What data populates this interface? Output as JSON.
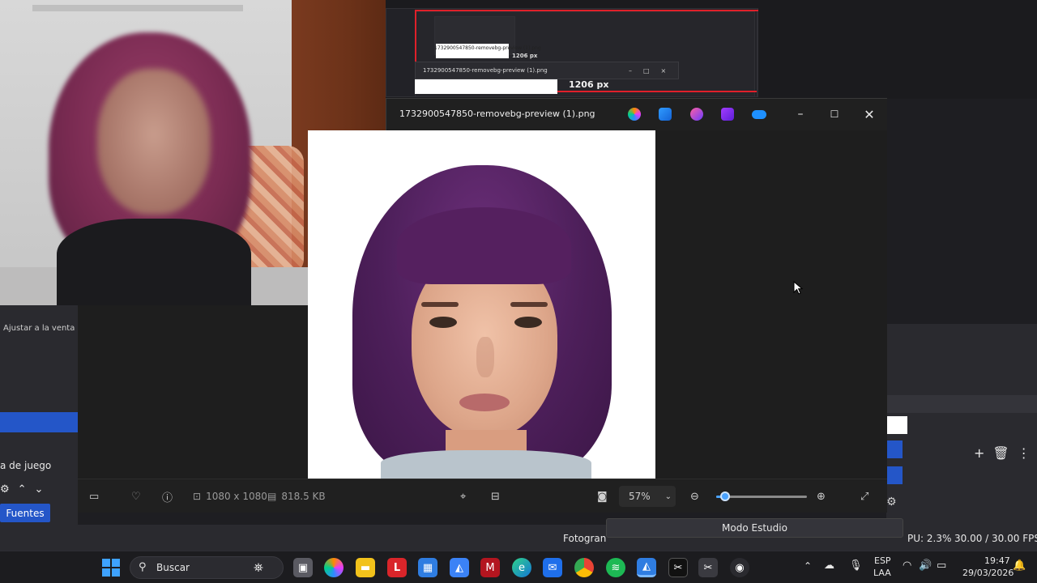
{
  "colors": {
    "accent": "#2456c8",
    "zoom_accent": "#4aa3ff",
    "window_bg": "#202020",
    "red_outline": "#e0202a"
  },
  "nested_capture": {
    "title_small": "1732900547850-removebg-preview (1).png",
    "px_small": "1206 px",
    "px_large": "1206 px"
  },
  "obs": {
    "fit_window": "Ajustar a la venta",
    "game_capture": "a de juego",
    "sources_tab": "Fuentes",
    "fotogram": "Fotogran",
    "studio_mode": "Modo Estudio",
    "cpu": "PU: 2.3%",
    "fps": "30.00 / 30.00 FPS"
  },
  "photos": {
    "title": "1732900547850-removebg-preview (1).png",
    "dimensions": "1080 x 1080",
    "file_size": "818.5 KB",
    "zoom": "57%",
    "zoom_fraction": 0.1
  },
  "taskbar": {
    "search_label": "Buscar",
    "lang_top": "ESP",
    "lang_bottom": "LAA",
    "time": "19:47",
    "date": "29/03/2026"
  }
}
